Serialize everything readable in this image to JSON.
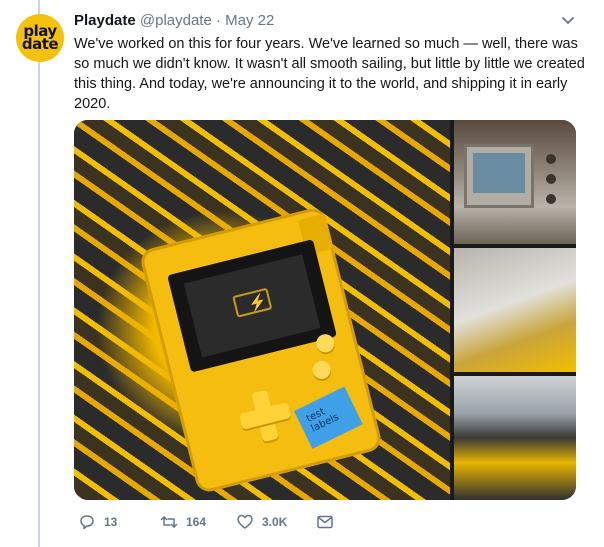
{
  "tweet": {
    "avatar_text_top": "play",
    "avatar_text_bottom": "date",
    "author_name": "Playdate",
    "handle": "@playdate",
    "separator": "·",
    "date": "May 22",
    "text": "We've worked on this for four years. We've learned so much — well, there was so much we didn't know. It wasn't all smooth sailing, but little by little we created this thing. And today, we're announcing it to the world, and shipping it in early 2020.",
    "media": {
      "tape_text": "test\nlabels"
    },
    "actions": {
      "reply_count": "13",
      "retweet_count": "164",
      "like_count": "3.0K"
    }
  },
  "colors": {
    "brand_yellow": "#f4c20d",
    "meta_gray": "#657786",
    "thread_line": "#ccd6dd"
  },
  "icons": [
    "chevron-down-icon",
    "reply-icon",
    "retweet-icon",
    "like-icon",
    "direct-message-icon"
  ]
}
